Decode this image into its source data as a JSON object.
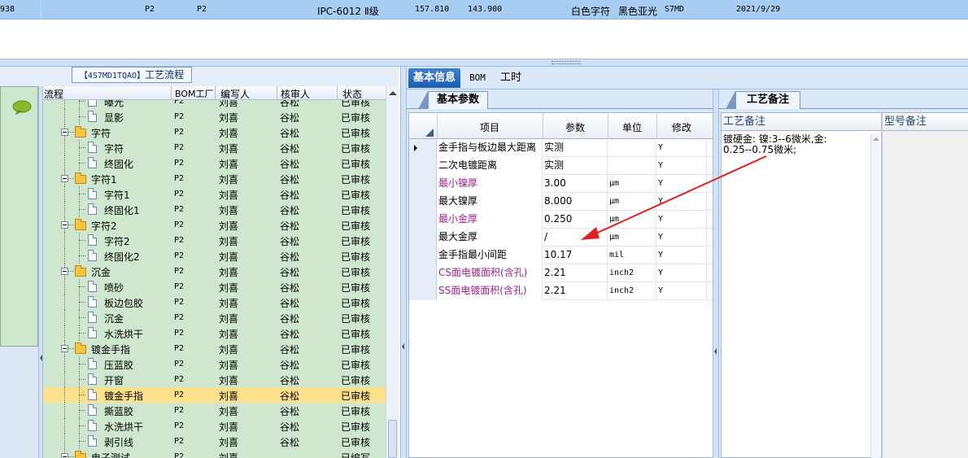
{
  "top_row": {
    "id_fragment": "938",
    "col_a": "P2",
    "col_b": "P2",
    "spec": "IPC-6012 Ⅱ级",
    "num1": "157.810",
    "num2": "143.900",
    "text1": "白色字符",
    "text2": "黑色亚光",
    "code": "S7MD",
    "date": "2021/9/29"
  },
  "left_panel": {
    "header_code": "【4S7MD1TQAO】",
    "header_title": "工艺流程",
    "columns": [
      "流程",
      "BOM工厂",
      "编写人",
      "核审人",
      "状态"
    ],
    "rows": [
      {
        "name": "曝光",
        "level": 1,
        "type": "doc",
        "bom": "P2",
        "writer": "刘喜",
        "reviewer": "谷松",
        "status": "已审核",
        "selected": false
      },
      {
        "name": "显影",
        "level": 1,
        "type": "doc",
        "bom": "P2",
        "writer": "刘喜",
        "reviewer": "谷松",
        "status": "已审核",
        "selected": false
      },
      {
        "name": "字符",
        "level": 0,
        "type": "folder",
        "bom": "P2",
        "writer": "刘喜",
        "reviewer": "谷松",
        "status": "已审核",
        "selected": false
      },
      {
        "name": "字符",
        "level": 1,
        "type": "doc",
        "bom": "P2",
        "writer": "刘喜",
        "reviewer": "谷松",
        "status": "已审核",
        "selected": false
      },
      {
        "name": "终固化",
        "level": 1,
        "type": "doc",
        "bom": "P2",
        "writer": "刘喜",
        "reviewer": "谷松",
        "status": "已审核",
        "selected": false
      },
      {
        "name": "字符1",
        "level": 0,
        "type": "folder",
        "bom": "P2",
        "writer": "刘喜",
        "reviewer": "谷松",
        "status": "已审核",
        "selected": false
      },
      {
        "name": "字符1",
        "level": 1,
        "type": "doc",
        "bom": "P2",
        "writer": "刘喜",
        "reviewer": "谷松",
        "status": "已审核",
        "selected": false
      },
      {
        "name": "终固化1",
        "level": 1,
        "type": "doc",
        "bom": "P2",
        "writer": "刘喜",
        "reviewer": "谷松",
        "status": "已审核",
        "selected": false
      },
      {
        "name": "字符2",
        "level": 0,
        "type": "folder",
        "bom": "P2",
        "writer": "刘喜",
        "reviewer": "谷松",
        "status": "已审核",
        "selected": false
      },
      {
        "name": "字符2",
        "level": 1,
        "type": "doc",
        "bom": "P2",
        "writer": "刘喜",
        "reviewer": "谷松",
        "status": "已审核",
        "selected": false
      },
      {
        "name": "终固化2",
        "level": 1,
        "type": "doc",
        "bom": "P2",
        "writer": "刘喜",
        "reviewer": "谷松",
        "status": "已审核",
        "selected": false
      },
      {
        "name": "沉金",
        "level": 0,
        "type": "folder",
        "bom": "P2",
        "writer": "刘喜",
        "reviewer": "谷松",
        "status": "已审核",
        "selected": false
      },
      {
        "name": "喷砂",
        "level": 1,
        "type": "doc",
        "bom": "P2",
        "writer": "刘喜",
        "reviewer": "谷松",
        "status": "已审核",
        "selected": false
      },
      {
        "name": "板边包胶",
        "level": 1,
        "type": "doc",
        "bom": "P2",
        "writer": "刘喜",
        "reviewer": "谷松",
        "status": "已审核",
        "selected": false
      },
      {
        "name": "沉金",
        "level": 1,
        "type": "doc",
        "bom": "P2",
        "writer": "刘喜",
        "reviewer": "谷松",
        "status": "已审核",
        "selected": false
      },
      {
        "name": "水洗烘干",
        "level": 1,
        "type": "doc",
        "bom": "P2",
        "writer": "刘喜",
        "reviewer": "谷松",
        "status": "已审核",
        "selected": false
      },
      {
        "name": "镀金手指",
        "level": 0,
        "type": "folder",
        "bom": "P2",
        "writer": "刘喜",
        "reviewer": "谷松",
        "status": "已审核",
        "selected": false
      },
      {
        "name": "压蓝胶",
        "level": 1,
        "type": "doc",
        "bom": "P2",
        "writer": "刘喜",
        "reviewer": "谷松",
        "status": "已审核",
        "selected": false
      },
      {
        "name": "开窗",
        "level": 1,
        "type": "doc",
        "bom": "P2",
        "writer": "刘喜",
        "reviewer": "谷松",
        "status": "已审核",
        "selected": false
      },
      {
        "name": "镀金手指",
        "level": 1,
        "type": "doc",
        "bom": "P2",
        "writer": "刘喜",
        "reviewer": "谷松",
        "status": "已审核",
        "selected": true
      },
      {
        "name": "撕蓝胶",
        "level": 1,
        "type": "doc",
        "bom": "P2",
        "writer": "刘喜",
        "reviewer": "谷松",
        "status": "已审核",
        "selected": false
      },
      {
        "name": "水洗烘干",
        "level": 1,
        "type": "doc",
        "bom": "P2",
        "writer": "刘喜",
        "reviewer": "谷松",
        "status": "已审核",
        "selected": false
      },
      {
        "name": "剥引线",
        "level": 1,
        "type": "doc",
        "bom": "P2",
        "writer": "刘喜",
        "reviewer": "谷松",
        "status": "已审核",
        "selected": false
      },
      {
        "name": "电子测试",
        "level": 0,
        "type": "folder",
        "bom": "P2",
        "writer": "刘喜",
        "reviewer": "",
        "status": "已编写",
        "selected": false
      }
    ]
  },
  "tabs": [
    {
      "label": "基本信息",
      "active": true
    },
    {
      "label": "BOM",
      "active": false
    },
    {
      "label": "工时",
      "active": false
    }
  ],
  "params": {
    "subtab": "基本参数",
    "columns": [
      "项目",
      "参数",
      "单位",
      "修改"
    ],
    "rows": [
      {
        "item": "金手指与板边最大距离",
        "value": "实测",
        "unit": "",
        "modify": "Y",
        "magenta": false,
        "current": true
      },
      {
        "item": "二次电镀距离",
        "value": "实测",
        "unit": "",
        "modify": "Y",
        "magenta": false,
        "current": false
      },
      {
        "item": "最小镍厚",
        "value": "3.00",
        "unit": "μm",
        "modify": "Y",
        "magenta": true,
        "current": false
      },
      {
        "item": "最大镍厚",
        "value": "8.000",
        "unit": "μm",
        "modify": "Y",
        "magenta": false,
        "current": false
      },
      {
        "item": "最小金厚",
        "value": "0.250",
        "unit": "μm",
        "modify": "Y",
        "magenta": true,
        "current": false
      },
      {
        "item": "最大金厚",
        "value": "/",
        "unit": "μm",
        "modify": "Y",
        "magenta": false,
        "current": false
      },
      {
        "item": "金手指最小间距",
        "value": "10.17",
        "unit": "mil",
        "modify": "Y",
        "magenta": false,
        "current": false
      },
      {
        "item": "CS面电镀面积(含孔)",
        "value": "2.21",
        "unit": "inch2",
        "modify": "Y",
        "magenta": true,
        "current": false
      },
      {
        "item": "SS面电镀面积(含孔)",
        "value": "2.21",
        "unit": "inch2",
        "modify": "Y",
        "magenta": true,
        "current": false
      }
    ]
  },
  "notes": {
    "subtab": "工艺备注",
    "process_note_label": "工艺备注",
    "model_note_label": "型号备注",
    "process_note_line1": "镀硬金:    镍:3--6微米,金:",
    "process_note_line2": "0.25--0.75微米;"
  },
  "colors": {
    "accent": "#1e5db0",
    "selection": "#fde08c",
    "tree_bg": "#cfe6cf",
    "magenta_text": "#a0208c",
    "annotation_arrow": "#e02020"
  }
}
